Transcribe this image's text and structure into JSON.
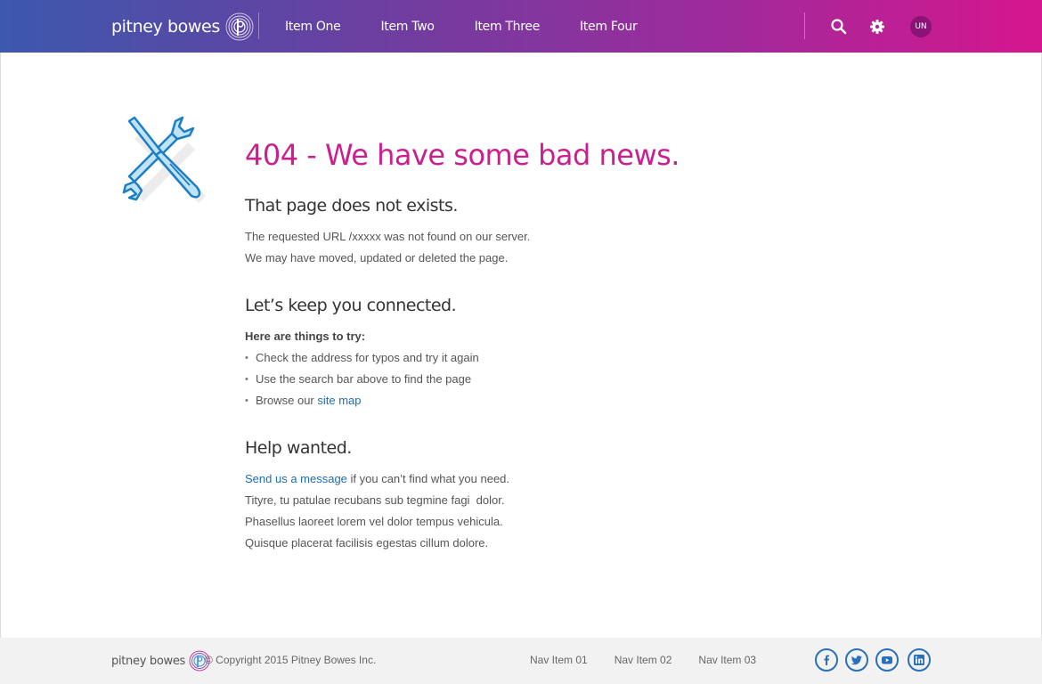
{
  "header": {
    "logo_text": "pitney bowes",
    "nav_items": [
      "Item One",
      "Item Two",
      "Item Three",
      "Item Four"
    ],
    "avatar_initials": "UN",
    "icons": [
      "search-icon",
      "gear-icon"
    ]
  },
  "main": {
    "heading": "404 - We have some bad news.",
    "section1": {
      "title": "That page does not exists.",
      "line1": "The requested URL /xxxxx was not found on our server.",
      "line2": "We may have moved, updated or deleted the page."
    },
    "section2": {
      "title": "Let’s keep you connected.",
      "intro": "Here are things to try:",
      "bullets": [
        "Check the address for typos and try it again",
        "Use the search bar above to find the page",
        "Browse our "
      ],
      "sitemap_link": "site map"
    },
    "section3": {
      "title": "Help wanted.",
      "message_link": "Send us a message",
      "message_rest": " if you can’t find what you need.",
      "line2": "Tityre, tu patulae recubans sub tegmine fagi  dolor.",
      "line3": "Phasellus laoreet lorem vel dolor tempus vehicula.",
      "line4": "Quisque placerat facilisis egestas cillum dolore."
    }
  },
  "footer": {
    "logo_text": "pitney bowes",
    "copyright": "© Copyright 2015 Pitney Bowes Inc.",
    "nav_items": [
      "Nav Item 01",
      "Nav Item 02",
      "Nav Item 03"
    ],
    "social": [
      "facebook-icon",
      "twitter-icon",
      "youtube-icon",
      "linkedin-icon"
    ]
  },
  "colors": {
    "accent": "#cc1f8f",
    "link": "#1d6eb5",
    "header_start": "#3c58ad",
    "header_end": "#d6168e"
  }
}
